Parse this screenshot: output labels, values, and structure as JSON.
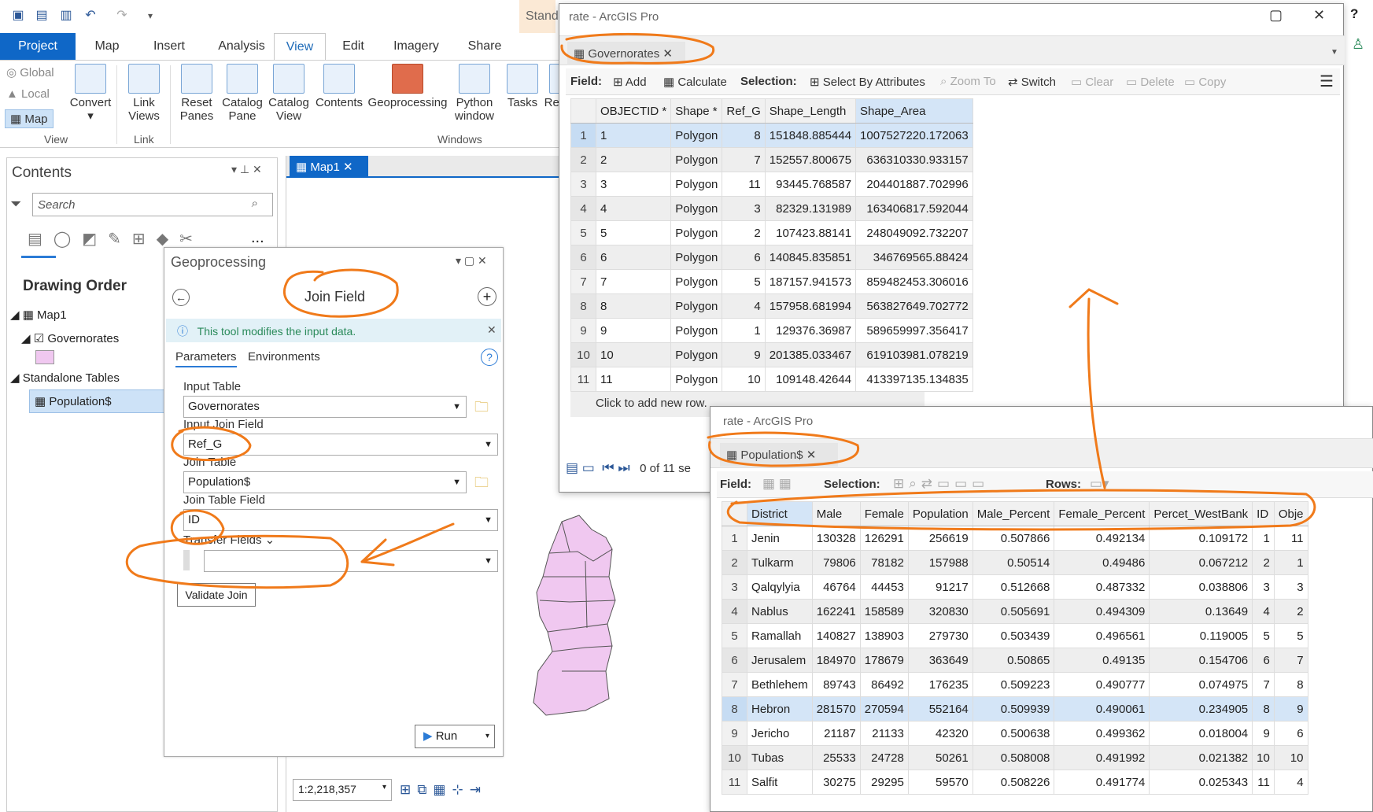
{
  "qat": {
    "undo_icon": "undo-icon",
    "redo_icon": "redo-icon"
  },
  "tabs": [
    "Project",
    "Map",
    "Insert",
    "Analysis",
    "View",
    "Edit",
    "Imagery",
    "Share"
  ],
  "ribbon": {
    "view_small": [
      "Global",
      "Local",
      "Map"
    ],
    "convert": "Convert",
    "link_views": "Link Views",
    "reset_panes": "Reset Panes",
    "catalog_pane": "Catalog Pane",
    "catalog_view": "Catalog View",
    "contents": "Contents",
    "geoprocessing": "Geoprocessing",
    "python_window": "Python window",
    "tasks": "Tasks",
    "rev": "Rev",
    "groups": [
      "View",
      "Link",
      "Windows"
    ],
    "stand": "Stand"
  },
  "contents_pane": {
    "title": "Contents",
    "search_placeholder": "Search",
    "drawing_order": "Drawing Order",
    "map_item": "Map1",
    "layer": "Governorates",
    "standalone": "Standalone Tables",
    "table_item": "Population$",
    "more": "..."
  },
  "map_tab": "Map1",
  "scale": "1:2,218,357",
  "geoprocessing": {
    "title": "Geoprocessing",
    "tool": "Join Field",
    "info": "This tool modifies the input data.",
    "tab_params": "Parameters",
    "tab_env": "Environments",
    "input_table_label": "Input Table",
    "input_table": "Governorates",
    "input_join_label": "Input Join Field",
    "input_join": "Ref_G",
    "join_table_label": "Join Table",
    "join_table": "Population$",
    "join_field_label": "Join Table Field",
    "join_field": "ID",
    "transfer_label": "Transfer Fields",
    "validate": "Validate Join",
    "run": "Run"
  },
  "gov_window": {
    "title": "rate - ArcGIS Pro",
    "tab": "Governorates",
    "field_label": "Field:",
    "add": "Add",
    "calculate": "Calculate",
    "selection_label": "Selection:",
    "select_by_attr": "Select By Attributes",
    "zoom_to": "Zoom To",
    "switch": "Switch",
    "clear": "Clear",
    "delete": "Delete",
    "copy": "Copy",
    "columns": [
      "OBJECTID *",
      "Shape *",
      "Ref_G",
      "Shape_Length",
      "Shape_Area"
    ],
    "rows": [
      [
        "1",
        "Polygon",
        "8",
        "151848.885444",
        "1007527220.172063"
      ],
      [
        "2",
        "Polygon",
        "7",
        "152557.800675",
        "636310330.933157"
      ],
      [
        "3",
        "Polygon",
        "11",
        "93445.768587",
        "204401887.702996"
      ],
      [
        "4",
        "Polygon",
        "3",
        "82329.131989",
        "163406817.592044"
      ],
      [
        "5",
        "Polygon",
        "2",
        "107423.88141",
        "248049092.732207"
      ],
      [
        "6",
        "Polygon",
        "6",
        "140845.835851",
        "346769565.88424"
      ],
      [
        "7",
        "Polygon",
        "5",
        "187157.941573",
        "859482453.306016"
      ],
      [
        "8",
        "Polygon",
        "4",
        "157958.681994",
        "563827649.702772"
      ],
      [
        "9",
        "Polygon",
        "1",
        "129376.36987",
        "589659997.356417"
      ],
      [
        "10",
        "Polygon",
        "9",
        "201385.033467",
        "619103981.078219"
      ],
      [
        "11",
        "Polygon",
        "10",
        "109148.42644",
        "413397135.134835"
      ]
    ],
    "add_row": "Click to add new row.",
    "status": "0 of 11 se"
  },
  "pop_window": {
    "title": "rate - ArcGIS Pro",
    "tab": "Population$",
    "field_label": "Field:",
    "selection_label": "Selection:",
    "rows_label": "Rows:",
    "columns": [
      "District",
      "Male",
      "Female",
      "Population",
      "Male_Percent",
      "Female_Percent",
      "Percet_WestBank",
      "ID",
      "Obje"
    ],
    "rows": [
      [
        "Jenin",
        "130328",
        "126291",
        "256619",
        "0.507866",
        "0.492134",
        "0.109172",
        "1",
        "11"
      ],
      [
        "Tulkarm",
        "79806",
        "78182",
        "157988",
        "0.50514",
        "0.49486",
        "0.067212",
        "2",
        "1"
      ],
      [
        "Qalqylyia",
        "46764",
        "44453",
        "91217",
        "0.512668",
        "0.487332",
        "0.038806",
        "3",
        "3"
      ],
      [
        "Nablus",
        "162241",
        "158589",
        "320830",
        "0.505691",
        "0.494309",
        "0.13649",
        "4",
        "2"
      ],
      [
        "Ramallah",
        "140827",
        "138903",
        "279730",
        "0.503439",
        "0.496561",
        "0.119005",
        "5",
        "5"
      ],
      [
        "Jerusalem",
        "184970",
        "178679",
        "363649",
        "0.50865",
        "0.49135",
        "0.154706",
        "6",
        "7"
      ],
      [
        "Bethlehem",
        "89743",
        "86492",
        "176235",
        "0.509223",
        "0.490777",
        "0.074975",
        "7",
        "8"
      ],
      [
        "Hebron",
        "281570",
        "270594",
        "552164",
        "0.509939",
        "0.490061",
        "0.234905",
        "8",
        "9"
      ],
      [
        "Jericho",
        "21187",
        "21133",
        "42320",
        "0.500638",
        "0.499362",
        "0.018004",
        "9",
        "6"
      ],
      [
        "Tubas",
        "25533",
        "24728",
        "50261",
        "0.508008",
        "0.491992",
        "0.021382",
        "10",
        "10"
      ],
      [
        "Salfit",
        "30275",
        "29295",
        "59570",
        "0.508226",
        "0.491774",
        "0.025343",
        "11",
        "4"
      ]
    ]
  },
  "help": "?",
  "colors": {
    "accent": "#0f67c7",
    "annotation": "#f07a1a",
    "polygon": "#f0c8f0"
  }
}
